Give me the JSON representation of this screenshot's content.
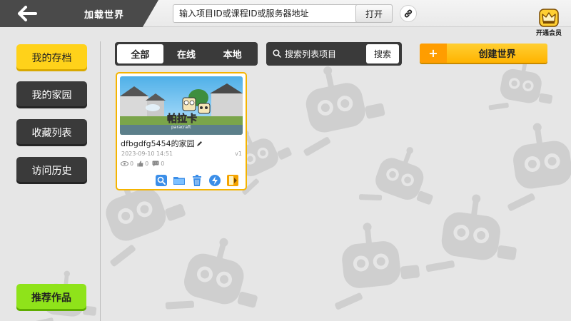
{
  "header": {
    "title": "加载世界",
    "address_placeholder": "输入项目ID或课程ID或服务器地址",
    "open_label": "打开",
    "vip_label": "开通会员"
  },
  "sidebar": {
    "items": [
      {
        "label": "我的存档",
        "active": true
      },
      {
        "label": "我的家园",
        "active": false
      },
      {
        "label": "收藏列表",
        "active": false
      },
      {
        "label": "访问历史",
        "active": false
      }
    ],
    "recommend_label": "推荐作品"
  },
  "tabs": [
    {
      "label": "全部",
      "active": true
    },
    {
      "label": "在线",
      "active": false
    },
    {
      "label": "本地",
      "active": false
    }
  ],
  "search": {
    "placeholder": "搜索列表项目",
    "button_label": "搜索"
  },
  "create": {
    "label": "创建世界"
  },
  "worlds": [
    {
      "title": "dfbgdfg5454的家园",
      "date": "2023-09-10 14:51",
      "version": "v1",
      "views": "0",
      "likes": "0",
      "comments": "0",
      "thumb_logo": "帕拉卡",
      "thumb_sub": "paracraft"
    }
  ],
  "icons": {
    "back": "back-arrow-icon",
    "link": "link-icon",
    "vip": "crown-icon",
    "search": "search-icon",
    "edit": "pencil-icon",
    "card_actions": [
      "search-world-icon",
      "folder-icon",
      "trash-icon",
      "upload-icon",
      "share-icon"
    ]
  },
  "colors": {
    "accent_yellow": "#ffd21a",
    "dark": "#3a3a3a",
    "green": "#8fe31a",
    "orange": "#ff9d00",
    "action_blue": "#3b8ee8"
  }
}
